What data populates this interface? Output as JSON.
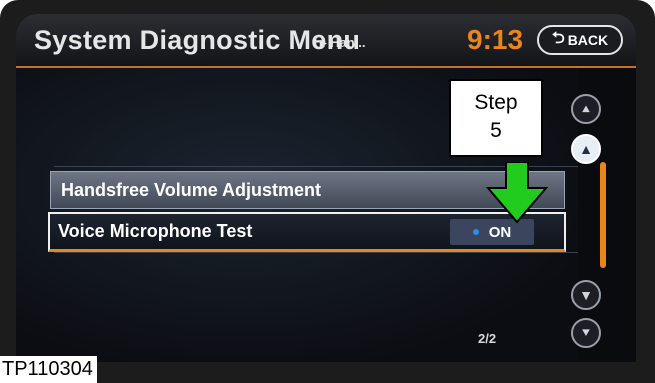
{
  "header": {
    "title": "System Diagnostic Menu",
    "breadcrumb": "▸ Han...",
    "time": "9:13",
    "back_label": "BACK"
  },
  "menu": {
    "items": [
      {
        "label": "Handsfree Volume Adjustment"
      },
      {
        "label": "Voice Microphone Test",
        "toggle": "ON"
      }
    ]
  },
  "scroll": {
    "page": "2/2"
  },
  "annotation": {
    "step_line1": "Step",
    "step_line2": "5"
  },
  "figure_code": "TP110304",
  "colors": {
    "accent": "#e8851c",
    "arrow": "#22cc1e",
    "toggle_bg": "#3b465e",
    "selected_item": "#5c6474"
  },
  "icons": [
    "back-arrow-icon",
    "page-up-icon",
    "scroll-up-icon",
    "scroll-down-icon",
    "page-down-icon"
  ]
}
